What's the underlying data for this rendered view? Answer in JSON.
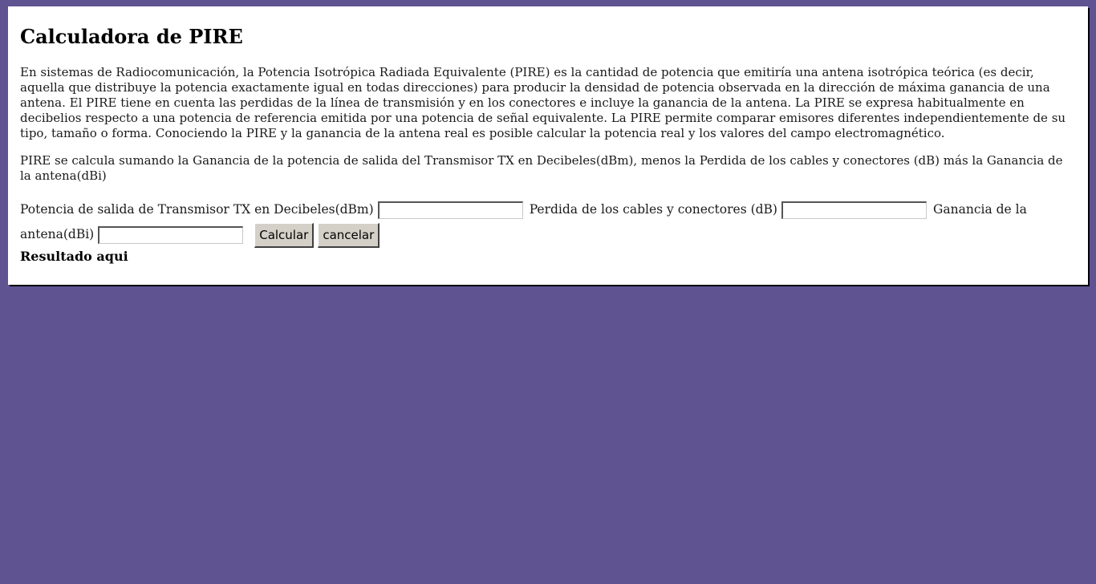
{
  "page": {
    "title": "Calculadora de PIRE",
    "intro": "En sistemas de Radiocomunicación, la Potencia Isotrópica Radiada Equivalente (PIRE) es la cantidad de potencia que emitiría una antena isotrópica teórica (es decir, aquella que distribuye la potencia exactamente igual en todas direcciones) para producir la densidad de potencia observada en la dirección de máxima ganancia de una antena. El PIRE tiene en cuenta las perdidas de la línea de transmisión y en los conectores e incluye la ganancia de la antena. La PIRE se expresa habitualmente en decibelios respecto a una potencia de referencia emitida por una potencia de señal equivalente. La PIRE permite comparar emisores diferentes independientemente de su tipo, tamaño o forma. Conociendo la PIRE y la ganancia de la antena real es posible calcular la potencia real y los valores del campo electromagnético.",
    "formula": "PIRE se calcula sumando la Ganancia de la potencia de salida del Transmisor TX en Decibeles(dBm), menos la Perdida de los cables y conectores (dB) más la Ganancia de la antena(dBi)"
  },
  "form": {
    "tx_label": "Potencia de salida de Transmisor TX en Decibeles(dBm)",
    "tx_value": "",
    "loss_label": "Perdida de los cables y conectores (dB)",
    "loss_value": "",
    "gain_label": "Ganancia de la antena(dBi)",
    "gain_value": "",
    "calc_button": "Calcular",
    "cancel_button": "cancelar"
  },
  "result": "Resultado aqui",
  "colors": {
    "background": "#5f5392",
    "panel": "#ffffff"
  }
}
